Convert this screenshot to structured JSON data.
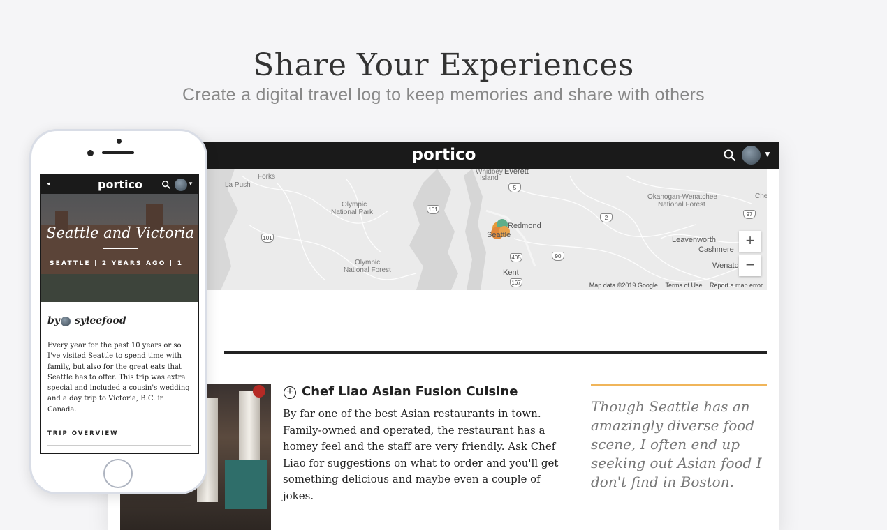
{
  "hero": {
    "title": "Share Your Experiences",
    "subtitle": "Create a digital travel log to keep memories and share with others"
  },
  "desktop": {
    "logo": "portico",
    "map": {
      "labels": {
        "la_push": "La Push",
        "forks": "Forks",
        "whidbey": "Whidbey",
        "island": "Island",
        "everett": "Everett",
        "olympic_np_1": "Olympic",
        "olympic_np_2": "National Park",
        "olympic_nf_1": "Olympic",
        "olympic_nf_2": "National Forest",
        "okanogan_1": "Okanogan-Wenatchee",
        "okanogan_2": "National Forest",
        "redmond": "Redmond",
        "seattle": "Seattle",
        "kent": "Kent",
        "leavenworth": "Leavenworth",
        "cashmere": "Cashmere",
        "wenatchee": "Wenatc",
        "chelan": "Che"
      },
      "highways": [
        "101",
        "101",
        "5",
        "2",
        "97",
        "90",
        "405",
        "167"
      ],
      "zoom_in": "+",
      "zoom_out": "−",
      "footer": {
        "map_data": "Map data ©2019 Google",
        "terms": "Terms of Use",
        "report": "Report a map error"
      }
    },
    "restaurant": {
      "name": "Chef Liao Asian Fusion Cuisine",
      "body": "By far one of the best Asian restaurants in town. Family-owned and operated, the restaurant has a homey feel and the staff are very friendly. Ask Chef Liao for suggestions on what to order and you'll get something delicious and maybe even a couple of jokes."
    },
    "quote": "Though Seattle has an amazingly diverse food scene, I often end up seeking out Asian food I don't find in Boston."
  },
  "mobile": {
    "logo": "portico",
    "back": "◂",
    "trip_title": "Seattle and Victoria",
    "trip_meta": "SEATTLE | 2 YEARS AGO | 1",
    "by": "by",
    "author": "syleefood",
    "description": "Every year for the past 10 years or so I've visited Seattle to spend time with family, but also for the great eats that Seattle has to offer. This trip was extra special and included a cousin's wedding and a day trip to Victoria, B.C. in Canada.",
    "overview_heading": "TRIP OVERVIEW"
  },
  "icons": {
    "search": "search-icon",
    "avatar": "avatar",
    "caret": "caret-down-icon",
    "plus": "plus-circle-icon"
  },
  "colors": {
    "nav_bg": "#1a1a1a",
    "accent": "#f0b55a",
    "page_bg": "#f5f5f7"
  }
}
